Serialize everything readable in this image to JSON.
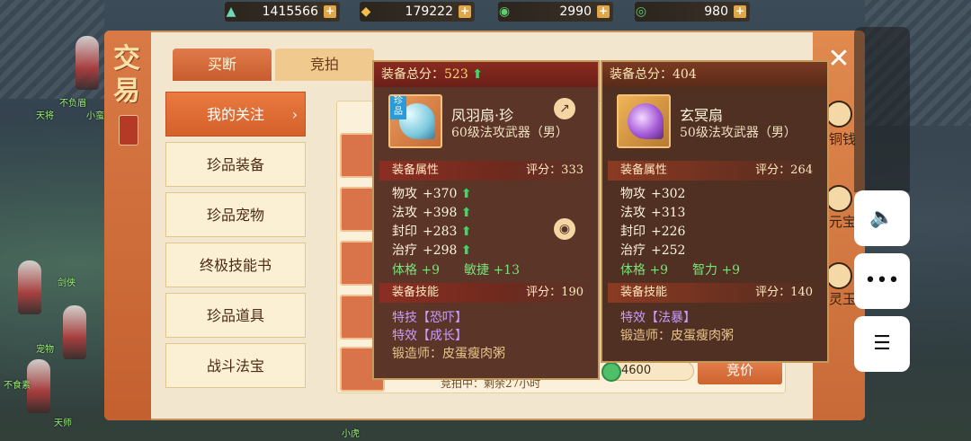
{
  "currency": [
    {
      "icon": "jade-icon",
      "value": "1415566"
    },
    {
      "icon": "gold-ingot-icon",
      "value": "179222"
    },
    {
      "icon": "coin-icon",
      "value": "2990"
    },
    {
      "icon": "green-ring-icon",
      "value": "980"
    }
  ],
  "panel": {
    "title": "交易",
    "tabs": [
      "买断",
      "竞拍"
    ],
    "menu": [
      "我的关注",
      "珍品装备",
      "珍品宠物",
      "终极技能书",
      "珍品道具",
      "战斗法宝"
    ],
    "side_labels": [
      "铜钱",
      "元宝",
      "灵玉"
    ],
    "bid_label": "竞价",
    "price": "4600",
    "time_text": "竞拍中：剩余27小时"
  },
  "tooltip_left": {
    "total_label": "装备总分：",
    "total_score": "523",
    "badge": "珍品",
    "name": "凤羽扇·珍",
    "desc": "60级法攻武器（男）",
    "attr_title": "装备属性",
    "attr_score": "评分：333",
    "attrs": [
      {
        "label": "物攻",
        "value": "+370"
      },
      {
        "label": "法攻",
        "value": "+398"
      },
      {
        "label": "封印",
        "value": "+283"
      },
      {
        "label": "治疗",
        "value": "+298"
      }
    ],
    "green_attrs": [
      {
        "label": "体格",
        "value": "+9"
      },
      {
        "label": "敏捷",
        "value": "+13"
      }
    ],
    "skill_title": "装备技能",
    "skill_score": "评分：190",
    "skills": [
      "特技【恐吓】",
      "特效【成长】"
    ],
    "smith": "锻造师：皮蛋瘦肉粥"
  },
  "tooltip_right": {
    "total_label": "装备总分：",
    "total_score": "404",
    "name": "玄冥扇",
    "desc": "50级法攻武器（男）",
    "attr_title": "装备属性",
    "attr_score": "评分：264",
    "attrs": [
      {
        "label": "物攻",
        "value": "+302"
      },
      {
        "label": "法攻",
        "value": "+313"
      },
      {
        "label": "封印",
        "value": "+226"
      },
      {
        "label": "治疗",
        "value": "+252"
      }
    ],
    "green_attrs": [
      {
        "label": "体格",
        "value": "+9"
      },
      {
        "label": "智力",
        "value": "+9"
      }
    ],
    "skill_title": "装备技能",
    "skill_score": "评分：140",
    "skills": [
      "特效【法暴】"
    ],
    "smith": "锻造师：皮蛋瘦肉粥"
  },
  "world": {
    "npc_names": [
      "天将",
      "小蛮",
      "不负眉",
      "剑侠",
      "宠物",
      "不食素",
      "天师",
      "小虎"
    ]
  },
  "system_buttons": [
    "volume-icon",
    "more-icon",
    "settings-sliders-icon"
  ]
}
